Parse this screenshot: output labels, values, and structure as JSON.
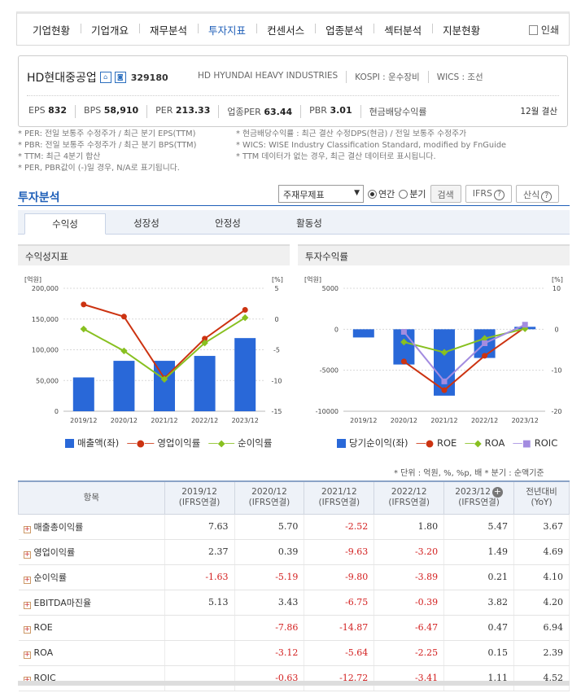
{
  "nav": {
    "items": [
      "기업현황",
      "기업개요",
      "재무분석",
      "투자지표",
      "컨센서스",
      "업종분석",
      "섹터분석",
      "지분현황"
    ],
    "active": "투자지표",
    "print_label": "인쇄"
  },
  "company": {
    "name": "HD현대중공업",
    "badge1": "A",
    "badge2": "B",
    "code": "329180",
    "english_name": "HD HYUNDAI HEAVY INDUSTRIES",
    "market": "KOSPI : 운수장비",
    "wics": "WICS : 조선",
    "stats": [
      {
        "label": "EPS",
        "value": "832"
      },
      {
        "label": "BPS",
        "value": "58,910"
      },
      {
        "label": "PER",
        "value": "213.33"
      },
      {
        "label": "업종PER",
        "value": "63.44"
      },
      {
        "label": "PBR",
        "value": "3.01"
      },
      {
        "label": "현금배당수익률",
        "value": ""
      }
    ],
    "settlement": "12월 결산"
  },
  "notes_left": [
    "* PER: 전일 보통주 수정주가 / 최근 분기 EPS(TTM)",
    "* PBR: 전일 보통주 수정주가 / 최근 분기 BPS(TTM)",
    "* TTM: 최근 4분기 합산",
    "* PER, PBR값이 (-)일 경우, N/A로 표기됩니다."
  ],
  "notes_right": [
    "* 현금배당수익률 : 최근 결산 수정DPS(현금) / 전일 보통주 수정주가",
    "* WICS: WISE Industry Classification Standard, modified by FnGuide",
    "* TTM 데이터가 없는 경우, 최근 결산 데이터로 표시됩니다."
  ],
  "section": {
    "title": "투자분석",
    "select_value": "주재무제표",
    "radio_annual": "연간",
    "radio_quarter": "분기",
    "search_btn": "검색",
    "ifrs_btn": "IFRS",
    "formula_btn": "산식",
    "help_glyph": "?"
  },
  "tabs": [
    "수익성",
    "성장성",
    "안정성",
    "활동성"
  ],
  "active_tab": "수익성",
  "chart_data": [
    {
      "type": "bar+line",
      "title": "수익성지표",
      "left_unit": "[억원]",
      "right_unit": "[%]",
      "categories": [
        "2019/12",
        "2020/12",
        "2021/12",
        "2022/12",
        "2023/12"
      ],
      "left_ylim": [
        0,
        200000
      ],
      "left_ticks": [
        "200,000",
        "150,000",
        "100,000",
        "50,000",
        "0"
      ],
      "right_ylim": [
        -15,
        5
      ],
      "right_ticks": [
        "5",
        "0",
        "-5",
        "-10",
        "-15"
      ],
      "bars": {
        "name": "매출액(좌)",
        "color": "#2968d8",
        "values": [
          55000,
          82000,
          82000,
          90000,
          119000
        ]
      },
      "lines": [
        {
          "name": "영업이익률",
          "color": "#cc3311",
          "values": [
            2.37,
            0.39,
            -9.63,
            -3.2,
            1.49
          ]
        },
        {
          "name": "순이익률",
          "color": "#88c020",
          "values": [
            -1.63,
            -5.19,
            -9.8,
            -3.89,
            0.21
          ]
        }
      ]
    },
    {
      "type": "bar+line",
      "title": "투자수익률",
      "left_unit": "[억원]",
      "right_unit": "[%]",
      "categories": [
        "2019/12",
        "2020/12",
        "2021/12",
        "2022/12",
        "2023/12"
      ],
      "left_ylim": [
        -10000,
        5000
      ],
      "left_ticks": [
        "5000",
        "0",
        "-5000",
        "-10000"
      ],
      "right_ylim": [
        -20,
        10
      ],
      "right_ticks": [
        "10",
        "0",
        "-10",
        "-20"
      ],
      "bars": {
        "name": "당기순이익(좌)",
        "color": "#2968d8",
        "values": [
          -1000,
          -4300,
          -8100,
          -3500,
          300
        ]
      },
      "lines": [
        {
          "name": "ROE",
          "color": "#cc3311",
          "values": [
            null,
            -7.86,
            -14.87,
            -6.47,
            0.47
          ]
        },
        {
          "name": "ROA",
          "color": "#88c020",
          "values": [
            null,
            -3.12,
            -5.64,
            -2.25,
            0.15
          ]
        },
        {
          "name": "ROIC",
          "color": "#a38ce0",
          "values": [
            null,
            -0.63,
            -12.72,
            -3.41,
            1.11
          ]
        }
      ]
    }
  ],
  "unit_note": "* 단위 : 억원, %, %p, 배     * 분기 : 순액기준",
  "table": {
    "headers": [
      {
        "line1": "항목",
        "line2": ""
      },
      {
        "line1": "2019/12",
        "line2": "(IFRS연결)"
      },
      {
        "line1": "2020/12",
        "line2": "(IFRS연결)"
      },
      {
        "line1": "2021/12",
        "line2": "(IFRS연결)"
      },
      {
        "line1": "2022/12",
        "line2": "(IFRS연결)"
      },
      {
        "line1": "2023/12",
        "line2": "(IFRS연결)"
      },
      {
        "line1": "전년대비",
        "line2": "(YoY)"
      }
    ],
    "rows": [
      {
        "label": "매출총이익률",
        "values": [
          "7.63",
          "5.70",
          "-2.52",
          "1.80",
          "5.47",
          "3.67"
        ]
      },
      {
        "label": "영업이익률",
        "values": [
          "2.37",
          "0.39",
          "-9.63",
          "-3.20",
          "1.49",
          "4.69"
        ]
      },
      {
        "label": "순이익률",
        "values": [
          "-1.63",
          "-5.19",
          "-9.80",
          "-3.89",
          "0.21",
          "4.10"
        ]
      },
      {
        "label": "EBITDA마진율",
        "values": [
          "5.13",
          "3.43",
          "-6.75",
          "-0.39",
          "3.82",
          "4.20"
        ]
      },
      {
        "label": "ROE",
        "values": [
          "",
          "-7.86",
          "-14.87",
          "-6.47",
          "0.47",
          "6.94"
        ]
      },
      {
        "label": "ROA",
        "values": [
          "",
          "-3.12",
          "-5.64",
          "-2.25",
          "0.15",
          "2.39"
        ]
      },
      {
        "label": "ROIC",
        "values": [
          "",
          "-0.63",
          "-12.72",
          "-3.41",
          "1.11",
          "4.52"
        ]
      }
    ]
  }
}
